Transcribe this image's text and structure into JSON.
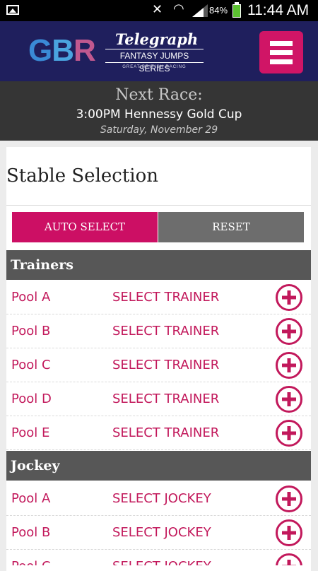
{
  "status_bar": {
    "battery_percent": "84%",
    "time": "11:44 AM",
    "icons": [
      "gallery-icon",
      "mute-icon",
      "wifi-icon",
      "signal-icon",
      "battery-icon"
    ]
  },
  "header": {
    "logo_text": "GBR",
    "brand": "Telegraph",
    "series": "FANTASY JUMPS SERIES",
    "tagline": "GREAT BRITISH RACING",
    "menu_icon": "hamburger-menu-icon"
  },
  "next_race": {
    "title": "Next Race:",
    "race": "3:00PM Hennessy Gold Cup",
    "date": "Saturday, November 29"
  },
  "stable": {
    "title": "Stable Selection",
    "auto_select_label": "AUTO SELECT",
    "reset_label": "RESET"
  },
  "trainers": {
    "heading": "Trainers",
    "rows": [
      {
        "pool": "Pool A",
        "action": "SELECT TRAINER"
      },
      {
        "pool": "Pool B",
        "action": "SELECT TRAINER"
      },
      {
        "pool": "Pool C",
        "action": "SELECT TRAINER"
      },
      {
        "pool": "Pool D",
        "action": "SELECT TRAINER"
      },
      {
        "pool": "Pool E",
        "action": "SELECT TRAINER"
      }
    ]
  },
  "jockey": {
    "heading": "Jockey",
    "rows": [
      {
        "pool": "Pool A",
        "action": "SELECT JOCKEY"
      },
      {
        "pool": "Pool B",
        "action": "SELECT JOCKEY"
      },
      {
        "pool": "Pool C",
        "action": "SELECT JOCKEY"
      }
    ]
  },
  "colors": {
    "brand_pink": "#cc0f64",
    "header_navy": "#1f1f5d",
    "section_gray": "#575757"
  }
}
